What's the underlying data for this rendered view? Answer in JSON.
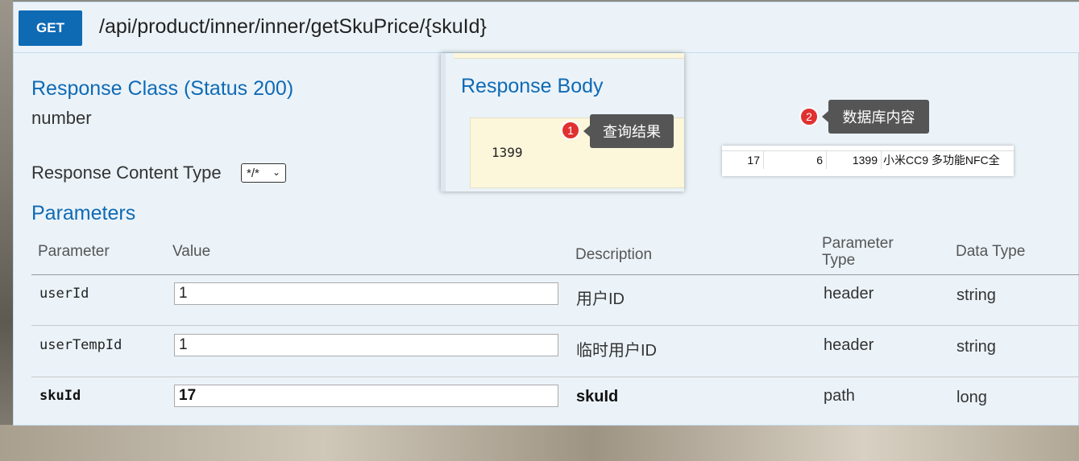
{
  "endpoint": {
    "method": "GET",
    "path": "/api/product/inner/inner/getSkuPrice/{skuId}"
  },
  "response_class": {
    "title": "Response Class (Status 200)",
    "type": "number"
  },
  "response_content_type": {
    "label": "Response Content Type",
    "selected": "*/*"
  },
  "parameters": {
    "title": "Parameters",
    "headers": {
      "parameter": "Parameter",
      "value": "Value",
      "description": "Description",
      "parameter_type": "Parameter Type",
      "data_type": "Data Type"
    },
    "rows": [
      {
        "name": "userId",
        "value": "1",
        "description": "用户ID",
        "param_type": "header",
        "data_type": "string"
      },
      {
        "name": "userTempId",
        "value": "1",
        "description": "临时用户ID",
        "param_type": "header",
        "data_type": "string"
      },
      {
        "name": "skuId",
        "value": "17",
        "description": "skuId",
        "param_type": "path",
        "data_type": "long"
      }
    ]
  },
  "response_body": {
    "title": "Response Body",
    "value": "1399"
  },
  "annotations": [
    {
      "number": "1",
      "text": "查询结果"
    },
    {
      "number": "2",
      "text": "数据库内容"
    }
  ],
  "db_snippet": {
    "row": [
      "17",
      "6",
      "1399",
      "小米CC9 多功能NFC全"
    ]
  },
  "colors": {
    "accent": "#0f6ab4",
    "panel_bg": "#ebf3f9",
    "code_bg": "#fcf6db",
    "badge": "#e03131",
    "tooltip": "#555555"
  }
}
